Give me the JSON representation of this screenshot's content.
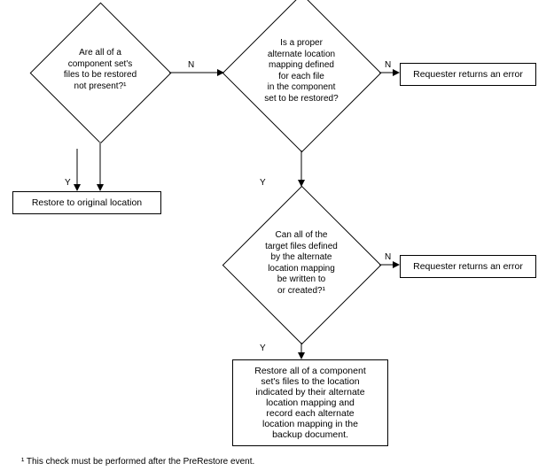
{
  "decisions": {
    "d1": "Are all of a\ncomponent set's\nfiles to be restored\nnot present?¹",
    "d2": "Is a proper\nalternate location\nmapping defined\nfor each file\nin the component\nset to be restored?",
    "d3": "Can all of the\ntarget files defined\nby the alternate\nlocation mapping\nbe written to\nor created?¹"
  },
  "actions": {
    "a1": "Restore to original location",
    "a2": "Requester returns an error",
    "a3": "Requester returns an error",
    "a4": "Restore all of a component\nset's files to the location\nindicated by their alternate\nlocation mapping and\nrecord each alternate\nlocation mapping in the\nbackup document."
  },
  "labels": {
    "yes": "Y",
    "no": "N"
  },
  "footnote": "¹ This check must be performed after the PreRestore event."
}
